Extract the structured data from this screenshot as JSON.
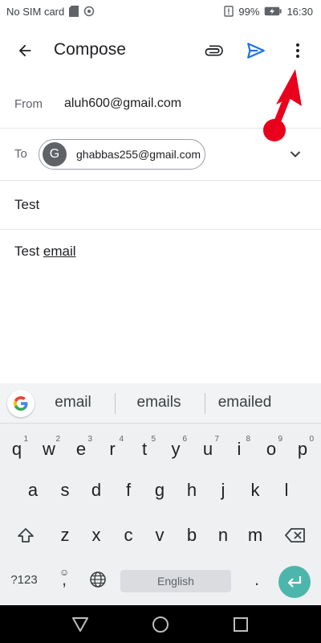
{
  "status_bar": {
    "carrier": "No SIM card",
    "battery": "99%",
    "time": "16:30"
  },
  "app_bar": {
    "title": "Compose",
    "back_icon": "arrow-back-icon",
    "attach_icon": "paperclip-icon",
    "send_icon": "send-icon",
    "more_icon": "more-vert-icon"
  },
  "compose": {
    "from_label": "From",
    "from_value": "aluh600@gmail.com",
    "to_label": "To",
    "to_chip": {
      "avatar_letter": "G",
      "email": "ghabbas255@gmail.com"
    },
    "subject": "Test",
    "body_prefix": "Test ",
    "body_underlined": "email"
  },
  "keyboard": {
    "suggestions": [
      "email",
      "emails",
      "emailed"
    ],
    "row1": [
      {
        "key": "q",
        "hint": "1"
      },
      {
        "key": "w",
        "hint": "2"
      },
      {
        "key": "e",
        "hint": "3"
      },
      {
        "key": "r",
        "hint": "4"
      },
      {
        "key": "t",
        "hint": "5"
      },
      {
        "key": "y",
        "hint": "6"
      },
      {
        "key": "u",
        "hint": "7"
      },
      {
        "key": "i",
        "hint": "8"
      },
      {
        "key": "o",
        "hint": "9"
      },
      {
        "key": "p",
        "hint": "0"
      }
    ],
    "row2": [
      "a",
      "s",
      "d",
      "f",
      "g",
      "h",
      "j",
      "k",
      "l"
    ],
    "row3": [
      "z",
      "x",
      "c",
      "v",
      "b",
      "n",
      "m"
    ],
    "symbols_label": "?123",
    "comma": ",",
    "space_label": "English",
    "period": "."
  },
  "colors": {
    "send_blue": "#1a73e8",
    "enter_teal": "#4db6ac",
    "annotation_red": "#e8001c"
  }
}
